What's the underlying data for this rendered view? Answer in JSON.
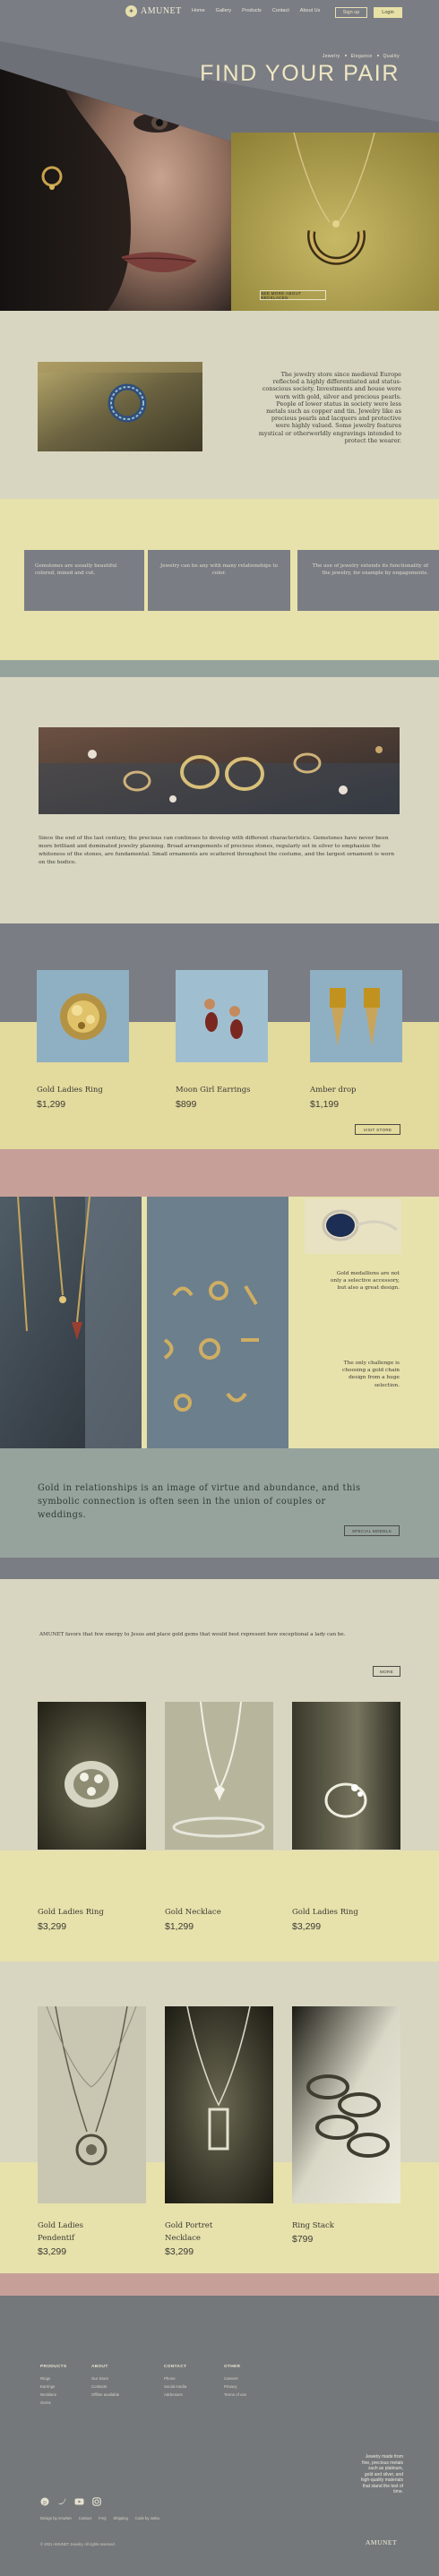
{
  "brand": {
    "name": "AMUNET",
    "mark": "✦"
  },
  "nav": {
    "items": [
      "Home",
      "Gallery",
      "Products",
      "Contact",
      "About Us"
    ]
  },
  "header": {
    "signup": "Sign up",
    "login": "Login"
  },
  "hero": {
    "subtitle_parts": [
      "Jewelry",
      "Elegance",
      "Quality"
    ],
    "title": "FIND YOUR PAIR",
    "cta": "SEE MORE ABOUT NECKLACES"
  },
  "about": {
    "text": "The jewelry store since medieval Europe reflected a highly differentiated and status-conscious society. Investments and house were worn with gold, silver and precious pearls. People of lower status in society were less metals such as copper and tin. Jewelry like as precious pearls and lacquers and protective were highly valued. Some jewelry features mystical or otherworldly engravings intended to protect the wearer."
  },
  "features": [
    "Gemstones are usually beautiful colored, mined and cut.",
    "Jewelry can be any with many relationships to color.",
    "The use of jewelry extends its functionality of the jewelry, for example by engagements."
  ],
  "history": {
    "text": "Since the end of the last century, the precious can continues to develop with different characteristics. Gemstones have never been more brilliant and dominated jewelry planning. Broad arrangements of precious stones, regularly set in silver to emphasize the whiteness of the stones, are fundamental. Small ornaments are scattered throughout the costume, and the largest ornament is worn on the bodice."
  },
  "products_a": {
    "items": [
      {
        "name": "Gold Ladies Ring",
        "price": "$1,299"
      },
      {
        "name": "Moon Girl Earrings",
        "price": "$899"
      },
      {
        "name": "Amber drop",
        "price": "$1,199"
      }
    ],
    "cta": "VISIT STORE"
  },
  "gallery": {
    "text1": "Gold medallions are not only a selective accessory, but also a great design.",
    "text2": "The only challenge is choosing a gold chain design from a huge selection."
  },
  "quote": {
    "text": "Gold in relationships is an image of virtue and abundance, and this symbolic connection is often seen in the union of couples or weddings.",
    "cta": "SPECIAL MODELS"
  },
  "products_b": {
    "intro": "AMUNET favors that few energy to Jesus and place gold gems that would best represent how exceptional a lady can be.",
    "more": "MORE",
    "row1": [
      {
        "name": "Gold Ladies Ring",
        "price": "$3,299"
      },
      {
        "name": "Gold Necklace",
        "price": "$1,299"
      },
      {
        "name": "Gold Ladies Ring",
        "price": "$3,299"
      }
    ],
    "row2": [
      {
        "name": "Gold Ladies",
        "name2": "Pendentif",
        "price": "$3,299"
      },
      {
        "name": "Gold Portret",
        "name2": "Necklace",
        "price": "$3,299"
      },
      {
        "name": "Ring Stack",
        "name2": "",
        "price": "$799"
      }
    ]
  },
  "footer": {
    "cols": [
      {
        "title": "PRODUCTS",
        "items": [
          "Rings",
          "Earrings",
          "Necklace",
          "Gems"
        ]
      },
      {
        "title": "ABOUT",
        "items": [
          "Our Store",
          "Contacts",
          "Offline available"
        ]
      },
      {
        "title": "CONTACT",
        "items": [
          "Phone",
          "Social media",
          "Addresses"
        ]
      },
      {
        "title": "OTHER",
        "items": [
          "Careers",
          "Privacy",
          "Terms of use"
        ]
      }
    ],
    "links": [
      "Design by AmuNet",
      "Contact",
      "FAQ",
      "Shipping",
      "Code by Jurka"
    ],
    "tagline": "Jewelry made from fine, precious metals such as platinum, gold and silver, and high-quality materials that stand the test of time.",
    "copyright": "© 2021 AMUNET Jewelry. All rights reserved.",
    "brand": "AMUNET"
  },
  "colors": {
    "beige": "#d8d6c1",
    "yellow": "#e7e1ab",
    "grey": "#7b7d84",
    "sage": "#96a39d",
    "pink": "#c6a098"
  }
}
